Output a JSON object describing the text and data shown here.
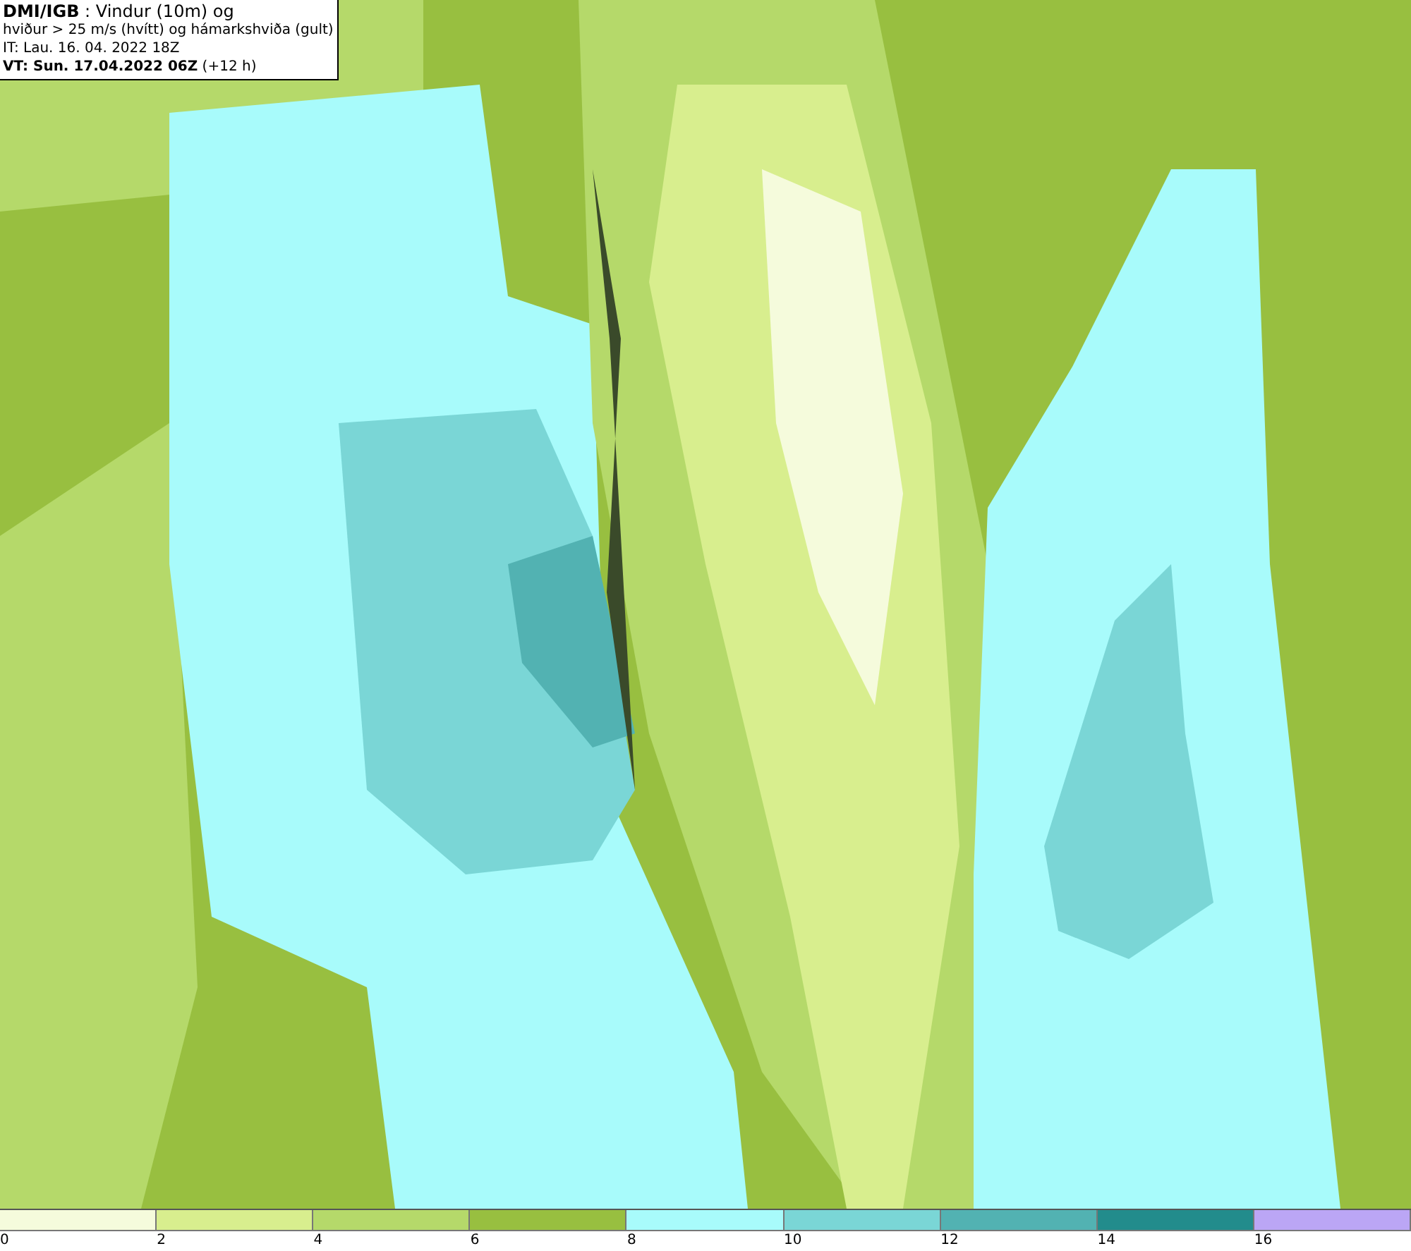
{
  "header": {
    "lines": [
      "**DMI/IGB** : Vindur (10m) og",
      "hviður > 25 m/s (hvítt) og hámarkshviða (gult)",
      "IT: Lau. 16. 04. 2022 18Z",
      "**VT: Sun. 17.04.2022 06Z** (+12 h)"
    ]
  },
  "legend": {
    "bins": [
      {
        "label": "0",
        "color": "#f5fbdc"
      },
      {
        "label": "2",
        "color": "#d8ee8e"
      },
      {
        "label": "4",
        "color": "#b5d96a"
      },
      {
        "label": "6",
        "color": "#98bf40"
      },
      {
        "label": "8",
        "color": "#a8fbfb"
      },
      {
        "label": "10",
        "color": "#7ad6d6"
      },
      {
        "label": "12",
        "color": "#52b2b2"
      },
      {
        "label": "14",
        "color": "#228c8c"
      },
      {
        "label": "16",
        "color": "#bba6f5"
      }
    ]
  }
}
